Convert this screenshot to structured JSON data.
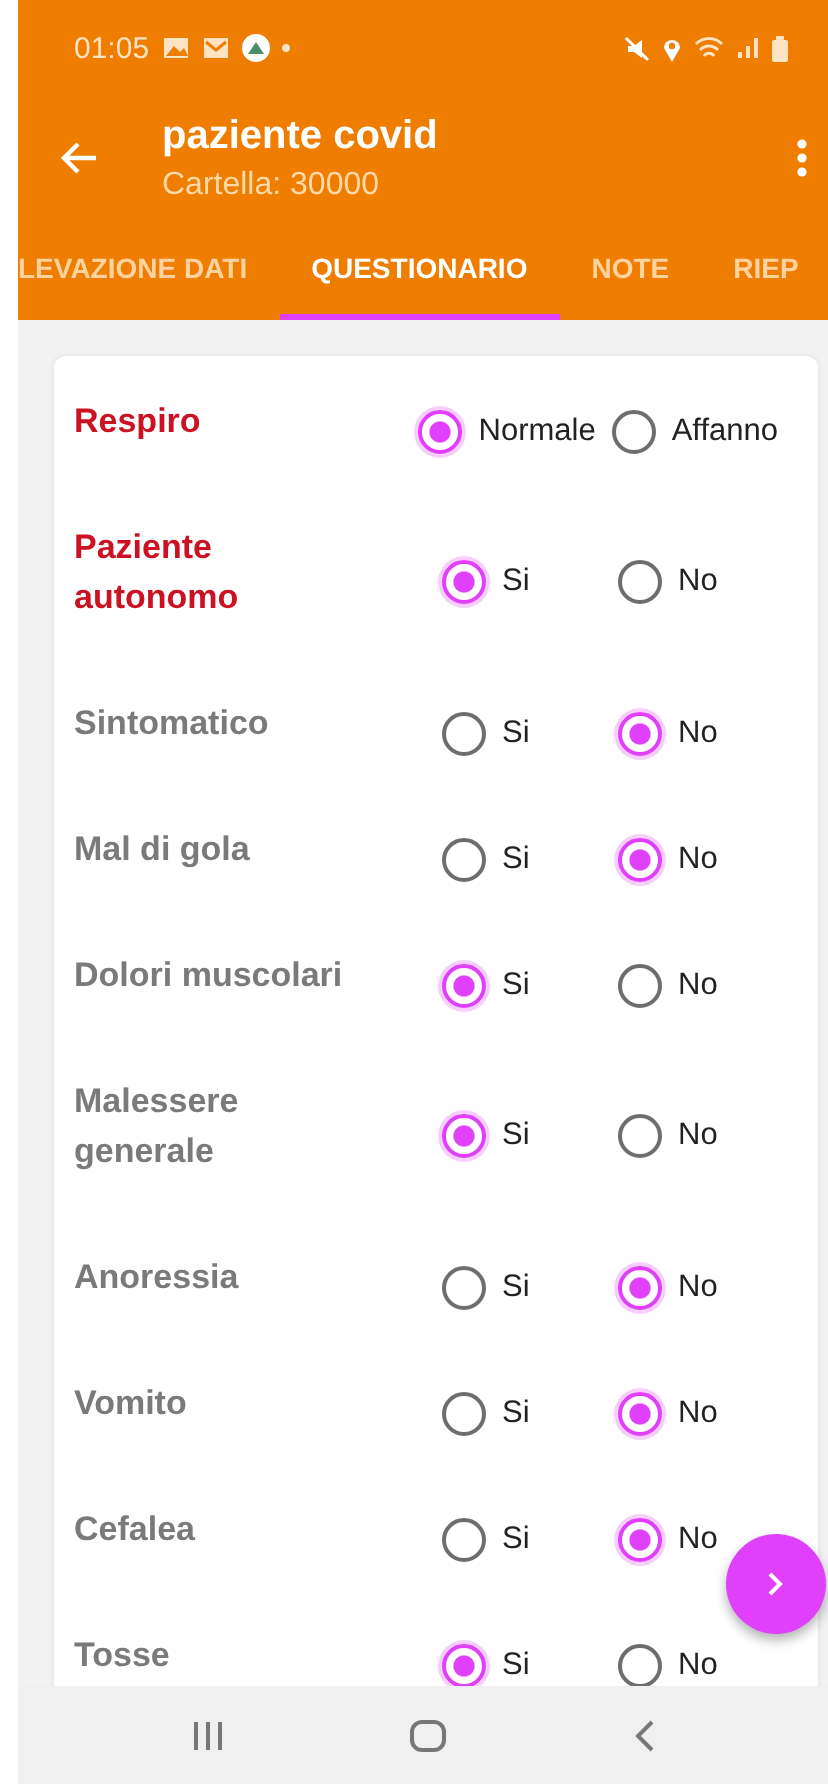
{
  "status_bar": {
    "time": "01:05"
  },
  "toolbar": {
    "title": "paziente covid",
    "subtitle": "Cartella: 30000"
  },
  "tabs": [
    {
      "label": "LEVAZIONE DATI",
      "selected": false
    },
    {
      "label": "QUESTIONARIO",
      "selected": true
    },
    {
      "label": "NOTE",
      "selected": false
    },
    {
      "label": "RIEP",
      "selected": false
    }
  ],
  "questions": [
    {
      "label": "Respiro",
      "required": true,
      "options": [
        {
          "label": "Normale",
          "selected": true
        },
        {
          "label": "Affanno",
          "selected": false
        }
      ]
    },
    {
      "label": "Paziente autonomo",
      "required": true,
      "options": [
        {
          "label": "Si",
          "selected": true
        },
        {
          "label": "No",
          "selected": false
        }
      ]
    },
    {
      "label": "Sintomatico",
      "required": false,
      "options": [
        {
          "label": "Si",
          "selected": false
        },
        {
          "label": "No",
          "selected": true
        }
      ]
    },
    {
      "label": "Mal di gola",
      "required": false,
      "options": [
        {
          "label": "Si",
          "selected": false
        },
        {
          "label": "No",
          "selected": true
        }
      ]
    },
    {
      "label": "Dolori muscolari",
      "required": false,
      "options": [
        {
          "label": "Si",
          "selected": true
        },
        {
          "label": "No",
          "selected": false
        }
      ]
    },
    {
      "label": "Malessere generale",
      "required": false,
      "options": [
        {
          "label": "Si",
          "selected": true
        },
        {
          "label": "No",
          "selected": false
        }
      ]
    },
    {
      "label": "Anoressia",
      "required": false,
      "options": [
        {
          "label": "Si",
          "selected": false
        },
        {
          "label": "No",
          "selected": true
        }
      ]
    },
    {
      "label": "Vomito",
      "required": false,
      "options": [
        {
          "label": "Si",
          "selected": false
        },
        {
          "label": "No",
          "selected": true
        }
      ]
    },
    {
      "label": "Cefalea",
      "required": false,
      "options": [
        {
          "label": "Si",
          "selected": false
        },
        {
          "label": "No",
          "selected": true
        }
      ]
    },
    {
      "label": "Tosse",
      "required": false,
      "options": [
        {
          "label": "Si",
          "selected": true
        },
        {
          "label": "No",
          "selected": false
        }
      ]
    }
  ]
}
